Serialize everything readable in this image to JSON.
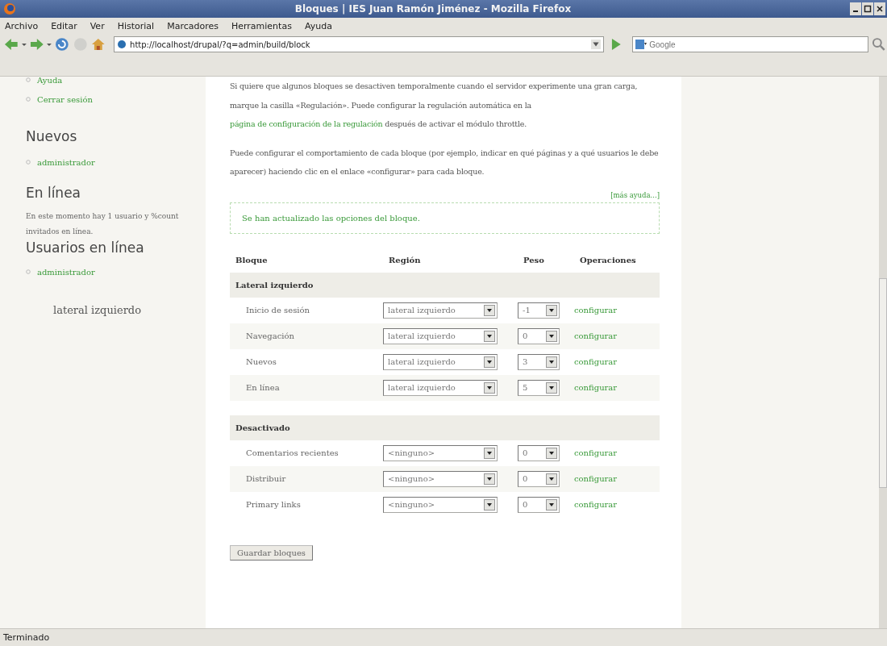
{
  "window": {
    "title": "Bloques | IES Juan Ramón Jiménez - Mozilla Firefox"
  },
  "menu_bar": [
    "Archivo",
    "Editar",
    "Ver",
    "Historial",
    "Marcadores",
    "Herramientas",
    "Ayuda"
  ],
  "toolbar": {
    "url": "http://localhost/drupal/?q=admin/build/block",
    "search_placeholder": "Google"
  },
  "sidebar": {
    "blocks": [
      {
        "links": [
          "Ayuda",
          "Cerrar sesión"
        ]
      },
      {
        "title": "Nuevos",
        "links": [
          "administrador"
        ]
      },
      {
        "title": "En línea",
        "text": "En este momento hay 1 usuario y %count invitados en línea.",
        "subtitle": "Usuarios en línea",
        "links": [
          "administrador"
        ]
      }
    ],
    "region_label": "lateral izquierdo"
  },
  "help": {
    "paragraph_1": {
      "before": "Si quiere que algunos bloques se desactiven temporalmente cuando el servidor experimente una gran carga, marque la casilla «Regulación». Puede configurar la regulación automática en la ",
      "link": "página de configuración de la regulación",
      "after": " después de activar el módulo throttle."
    },
    "paragraph_2": "Puede configurar el comportamiento de cada bloque (por ejemplo, indicar en qué páginas y a qué usuarios le debe aparecer) haciendo clic en el enlace «configurar» para cada bloque.",
    "more_help": "[más ayuda...]"
  },
  "status_message": "Se han actualizado las opciones del bloque.",
  "table": {
    "columns": [
      "Bloque",
      "Región",
      "Peso",
      "Operaciones"
    ],
    "sections": [
      {
        "title": "Lateral izquierdo",
        "rows": [
          {
            "block": "Inicio de sesión",
            "region": "lateral izquierdo",
            "weight": "-1",
            "operation": "configurar"
          },
          {
            "block": "Navegación",
            "region": "lateral izquierdo",
            "weight": "0",
            "operation": "configurar"
          },
          {
            "block": "Nuevos",
            "region": "lateral izquierdo",
            "weight": "3",
            "operation": "configurar"
          },
          {
            "block": "En línea",
            "region": "lateral izquierdo",
            "weight": "5",
            "operation": "configurar"
          }
        ]
      },
      {
        "title": "Desactivado",
        "rows": [
          {
            "block": "Comentarios recientes",
            "region": "<ninguno>",
            "weight": "0",
            "operation": "configurar"
          },
          {
            "block": "Distribuir",
            "region": "<ninguno>",
            "weight": "0",
            "operation": "configurar"
          },
          {
            "block": "Primary links",
            "region": "<ninguno>",
            "weight": "0",
            "operation": "configurar"
          }
        ]
      }
    ]
  },
  "save_button": "Guardar bloques",
  "status_bar": "Terminado"
}
